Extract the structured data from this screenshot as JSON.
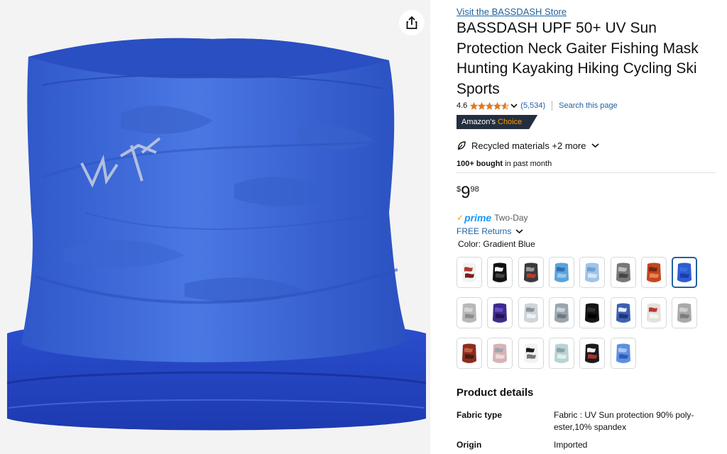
{
  "share": {
    "icon": "share-icon"
  },
  "product": {
    "store_link": "Visit the BASSDASH Store",
    "title": "BASSDASH UPF 50+ UV Sun Protection Neck Gaiter Fishing Mask Hunting Kayaking Hiking Cycling Ski Sports",
    "rating_value": "4.6",
    "rating_stars": 4.6,
    "rating_count": "(5,534)",
    "search_page": "Search this page",
    "badge_prefix": "Amazon's",
    "badge_choice": "Choice",
    "recycled": "Recycled materials +2 more",
    "bought_bold": "100+ bought",
    "bought_rest": " in past month",
    "price_symbol": "$",
    "price_whole": "9",
    "price_fraction": "98",
    "prime_label": "prime",
    "prime_delivery": "Two-Day",
    "returns": "FREE Returns",
    "color_label": "Color:",
    "color_value": "Gradient Blue",
    "colors_theme": {
      "selected_border": "#2162a1",
      "badge_bg": "#232f3e",
      "badge_accent": "#ff9900",
      "link": "#2162a1"
    }
  },
  "swatches": [
    {
      "name": "Red White Camo",
      "colors": [
        "#f2f2f2",
        "#b03a2e",
        "#7a1c14"
      ]
    },
    {
      "name": "Black White Floral",
      "colors": [
        "#111111",
        "#f5f5f5",
        "#444444"
      ]
    },
    {
      "name": "Dark Fish Pattern",
      "colors": [
        "#3a3a3a",
        "#9a9a9a",
        "#c0392b"
      ]
    },
    {
      "name": "Blue Gradient Fish",
      "colors": [
        "#5aa3d9",
        "#2f6fb0",
        "#9cc8ea"
      ]
    },
    {
      "name": "Light Blue",
      "colors": [
        "#9ec4ea",
        "#6f9fd0",
        "#d6e7f7"
      ]
    },
    {
      "name": "Gray Camo",
      "colors": [
        "#777777",
        "#bdbdbd",
        "#444444"
      ]
    },
    {
      "name": "Orange Camo",
      "colors": [
        "#c4461c",
        "#6b2a12",
        "#e8865a"
      ]
    },
    {
      "name": "Gradient Blue",
      "colors": [
        "#2f5bd3",
        "#3a6ee0",
        "#1c3ea6"
      ]
    },
    {
      "name": "Light Gray",
      "colors": [
        "#b8b8b8",
        "#d6d6d6",
        "#8c8c8c"
      ]
    },
    {
      "name": "Purple Camo",
      "colors": [
        "#3d2a8c",
        "#6a4bc4",
        "#1f1552"
      ]
    },
    {
      "name": "Silver Fish",
      "colors": [
        "#cfd4d9",
        "#8a959e",
        "#f0f2f4"
      ]
    },
    {
      "name": "Gray Blue",
      "colors": [
        "#9aa5ad",
        "#cdd3d8",
        "#6c7a84"
      ]
    },
    {
      "name": "Black",
      "colors": [
        "#141414",
        "#2e2e2e",
        "#000000"
      ]
    },
    {
      "name": "Blue White Camo",
      "colors": [
        "#3c5fb0",
        "#e8ecf5",
        "#1c357a"
      ]
    },
    {
      "name": "Red White Floral",
      "colors": [
        "#e6e0dc",
        "#b53a32",
        "#f5f5f5"
      ]
    },
    {
      "name": "Light Gray 2",
      "colors": [
        "#a9a9a9",
        "#cfcfcf",
        "#7d7d7d"
      ]
    },
    {
      "name": "Rust Camo",
      "colors": [
        "#8b2d1e",
        "#c06040",
        "#4a1a10"
      ]
    },
    {
      "name": "Pink Gray",
      "colors": [
        "#d7b3b6",
        "#9fa4ad",
        "#eadcdd"
      ]
    },
    {
      "name": "Black White Geometric",
      "colors": [
        "#f2f2f2",
        "#1a1a1a",
        "#777777"
      ]
    },
    {
      "name": "Mint Gray",
      "colors": [
        "#b9d3d3",
        "#8aa3a7",
        "#e3efef"
      ]
    },
    {
      "name": "Black White Dots",
      "colors": [
        "#1a1a1a",
        "#f0f0f0",
        "#b0302a"
      ]
    },
    {
      "name": "Blue Fade",
      "colors": [
        "#5c8fe0",
        "#a8c6f0",
        "#2e5cb8"
      ]
    }
  ],
  "selected_swatch_index": 7,
  "details": {
    "title": "Product details",
    "rows": [
      {
        "label": "Fabric type",
        "value": "Fabric : UV Sun protection 90% poly-ester,10% spandex"
      },
      {
        "label": "Origin",
        "value": "Imported"
      }
    ]
  }
}
